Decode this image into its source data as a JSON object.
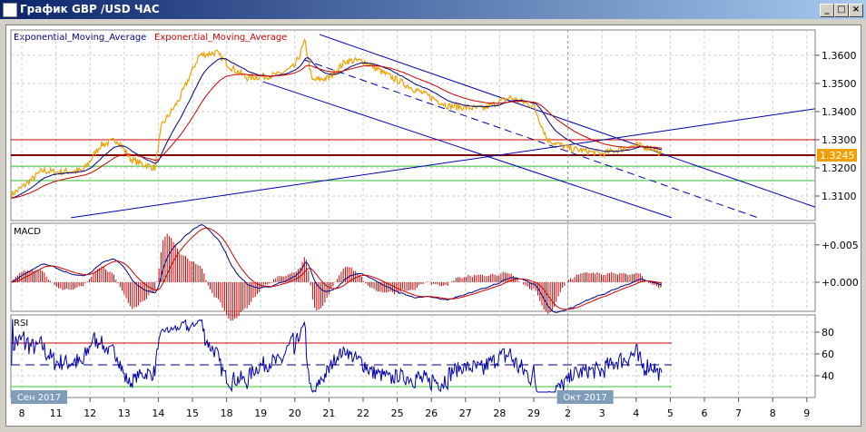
{
  "window": {
    "title": "График GBP /USD  ЧАС",
    "buttons": [
      "_",
      "□",
      "×"
    ]
  },
  "legend": {
    "ema1": "Exponential_Moving_Average",
    "ema2": "Exponential_Moving_Average"
  },
  "colors": {
    "price": "#f0a000",
    "ema_fast": "#000080",
    "ema_slow": "#cc0000",
    "current_price_bg": "#f0a000"
  },
  "chart_data": {
    "type": "line",
    "current_price": "1.3245",
    "price_axis": {
      "ylim": [
        1.3013,
        1.369
      ],
      "ticks": [
        "1.3600",
        "1.3500",
        "1.3400",
        "1.3300",
        "1.3200",
        "1.3100"
      ],
      "tick_values": [
        1.36,
        1.35,
        1.34,
        1.33,
        1.32,
        1.31
      ]
    },
    "x_labels": [
      "8",
      "11",
      "12",
      "13",
      "14",
      "15",
      "18",
      "19",
      "20",
      "21",
      "22",
      "25",
      "26",
      "27",
      "28",
      "29",
      "2",
      "3",
      "4",
      "5",
      "6",
      "7",
      "8",
      "9"
    ],
    "month_labels": [
      {
        "label": "Сен 2017",
        "day_index": 0
      },
      {
        "label": "Окт 2017",
        "day_index": 16
      }
    ],
    "price_keypoints": [
      [
        -0.3,
        1.3105
      ],
      [
        0,
        1.313
      ],
      [
        0.6,
        1.319
      ],
      [
        1,
        1.3185
      ],
      [
        1.8,
        1.319
      ],
      [
        2.3,
        1.328
      ],
      [
        2.8,
        1.33
      ],
      [
        3.2,
        1.323
      ],
      [
        3.5,
        1.3215
      ],
      [
        3.9,
        1.32
      ],
      [
        4.1,
        1.335
      ],
      [
        4.6,
        1.344
      ],
      [
        5.2,
        1.36
      ],
      [
        5.7,
        1.361
      ],
      [
        6.1,
        1.356
      ],
      [
        6.6,
        1.352
      ],
      [
        7.5,
        1.353
      ],
      [
        8,
        1.356
      ],
      [
        8.3,
        1.365
      ],
      [
        8.5,
        1.351
      ],
      [
        9,
        1.352
      ],
      [
        9.5,
        1.358
      ],
      [
        10,
        1.358
      ],
      [
        10.7,
        1.353
      ],
      [
        11.5,
        1.348
      ],
      [
        12.5,
        1.342
      ],
      [
        13.5,
        1.341
      ],
      [
        14.3,
        1.345
      ],
      [
        15,
        1.342
      ],
      [
        15.4,
        1.33
      ],
      [
        16,
        1.327
      ],
      [
        17,
        1.325
      ],
      [
        18,
        1.328
      ],
      [
        18.5,
        1.327
      ],
      [
        18.75,
        1.3245
      ]
    ],
    "horizontal_levels": [
      {
        "price": 1.33,
        "color": "#cc0000"
      },
      {
        "price": 1.3245,
        "color": "#800000"
      },
      {
        "price": 1.3206,
        "color": "#33bb33"
      },
      {
        "price": 1.3155,
        "color": "#33bb33"
      }
    ],
    "trend_lines": [
      {
        "from": [
          1.44,
          1.3023
        ],
        "to": [
          23.24,
          1.341
        ],
        "dashed": false
      },
      {
        "from": [
          8.72,
          1.3674
        ],
        "to": [
          23.24,
          1.3061
        ],
        "dashed": false
      },
      {
        "from": [
          8.27,
          1.3584
        ],
        "to": [
          21.57,
          1.3023
        ],
        "dashed": true
      },
      {
        "from": [
          7.07,
          1.3506
        ],
        "to": [
          19.04,
          1.3023
        ],
        "dashed": false
      }
    ],
    "macd": {
      "title": "MACD",
      "ylim": [
        -0.0039,
        0.0079
      ],
      "ticks": [
        "+0.005",
        "+0.000"
      ],
      "tick_values": [
        0.005,
        0
      ]
    },
    "rsi": {
      "title": "RSI",
      "ylim": [
        20,
        95.8
      ],
      "ticks": [
        "80",
        "60",
        "40"
      ],
      "tick_values": [
        80,
        60,
        40
      ],
      "levels": [
        70,
        50,
        30
      ]
    }
  }
}
